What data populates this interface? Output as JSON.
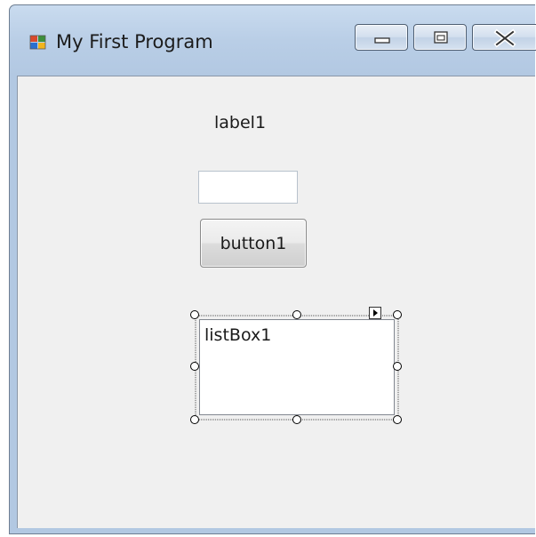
{
  "window": {
    "title": "My First Program",
    "icon": "windows-form-icon",
    "buttons": {
      "minimize_icon": "minimize-icon",
      "maximize_icon": "maximize-icon",
      "close_icon": "close-icon"
    }
  },
  "form": {
    "label1": {
      "text": "label1"
    },
    "textbox1": {
      "value": ""
    },
    "button1": {
      "label": "button1"
    },
    "listbox1": {
      "items": [
        "listBox1"
      ],
      "selected_in_designer": true,
      "smart_tag_icon": "smart-tag-arrow-icon"
    }
  },
  "colors": {
    "client_background": "#f0f0f0",
    "titlebar": "#b9cee6",
    "selection_handle": "#000000"
  }
}
